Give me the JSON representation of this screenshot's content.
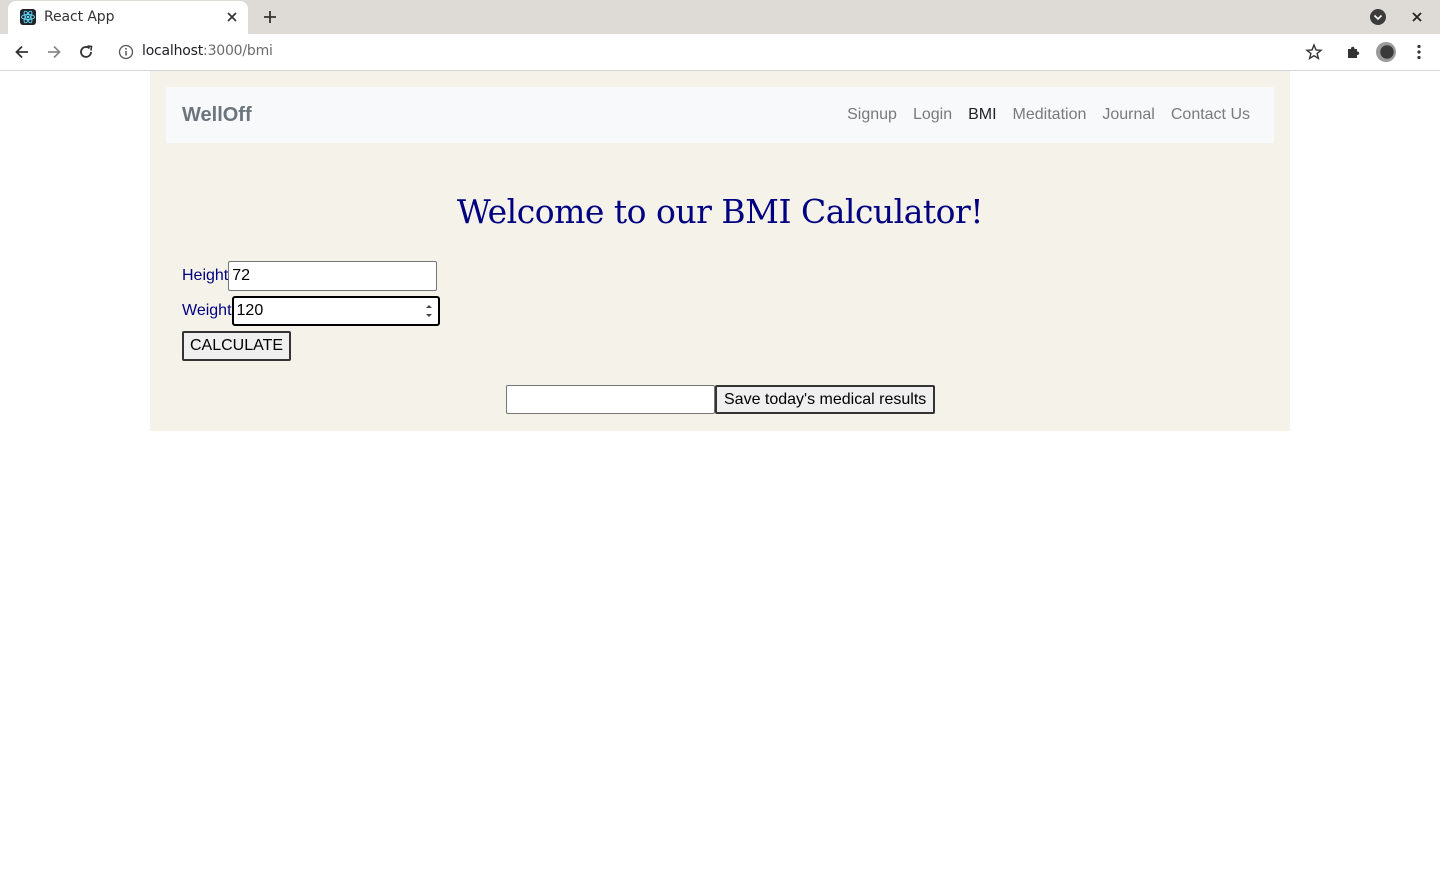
{
  "browser": {
    "tab_title": "React App",
    "url_host": "localhost",
    "url_path": ":3000/bmi"
  },
  "navbar": {
    "brand": "WellOff",
    "links": [
      {
        "label": "Signup",
        "active": false
      },
      {
        "label": "Login",
        "active": false
      },
      {
        "label": "BMI",
        "active": true
      },
      {
        "label": "Meditation",
        "active": false
      },
      {
        "label": "Journal",
        "active": false
      },
      {
        "label": "Contact Us",
        "active": false
      }
    ]
  },
  "page": {
    "title": "Welcome to our BMI Calculator!",
    "height_label": "Height",
    "height_value": "72",
    "weight_label": "Weight",
    "weight_value": "120",
    "calculate_label": "CALCULATE",
    "save_input_value": "",
    "save_label": "Save today's medical results"
  },
  "colors": {
    "page_bg": "#f5f2ea",
    "navbar_bg": "#f8f9fa",
    "heading": "#000080",
    "labels": "#000080"
  }
}
